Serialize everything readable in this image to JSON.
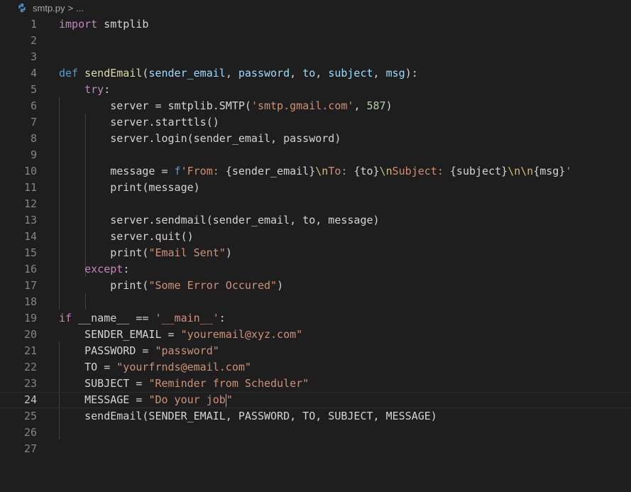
{
  "breadcrumb": {
    "file": "smtp.py",
    "separator": ">",
    "more": "..."
  },
  "lines": [
    {
      "n": "1",
      "code": "import smtplib"
    },
    {
      "n": "2",
      "code": ""
    },
    {
      "n": "3",
      "code": ""
    },
    {
      "n": "4",
      "code": "def sendEmail(sender_email, password, to, subject, msg):"
    },
    {
      "n": "5",
      "code": "    try:"
    },
    {
      "n": "6",
      "code": "        server = smtplib.SMTP('smtp.gmail.com', 587)"
    },
    {
      "n": "7",
      "code": "        server.starttls()"
    },
    {
      "n": "8",
      "code": "        server.login(sender_email, password)"
    },
    {
      "n": "9",
      "code": ""
    },
    {
      "n": "10",
      "code": "        message = f'From: {sender_email}\\nTo: {to}\\nSubject: {subject}\\n\\n{msg}'"
    },
    {
      "n": "11",
      "code": "        print(message)"
    },
    {
      "n": "12",
      "code": ""
    },
    {
      "n": "13",
      "code": "        server.sendmail(sender_email, to, message)"
    },
    {
      "n": "14",
      "code": "        server.quit()"
    },
    {
      "n": "15",
      "code": "        print(\"Email Sent\")"
    },
    {
      "n": "16",
      "code": "    except:"
    },
    {
      "n": "17",
      "code": "        print(\"Some Error Occured\")"
    },
    {
      "n": "18",
      "code": ""
    },
    {
      "n": "19",
      "code": "if __name__ == '__main__':"
    },
    {
      "n": "20",
      "code": "    SENDER_EMAIL = \"youremail@xyz.com\""
    },
    {
      "n": "21",
      "code": "    PASSWORD = \"password\""
    },
    {
      "n": "22",
      "code": "    TO = \"yourfrnds@email.com\""
    },
    {
      "n": "23",
      "code": "    SUBJECT = \"Reminder from Scheduler\""
    },
    {
      "n": "24",
      "code": "    MESSAGE = \"Do your job\""
    },
    {
      "n": "25",
      "code": "    sendEmail(SENDER_EMAIL, PASSWORD, TO, SUBJECT, MESSAGE)"
    },
    {
      "n": "26",
      "code": ""
    },
    {
      "n": "27",
      "code": ""
    }
  ],
  "active_line": 24,
  "colors": {
    "background": "#1e1e1e",
    "keyword": "#569cd6",
    "control_keyword": "#c586c0",
    "string": "#ce9178",
    "number": "#b5cea8",
    "line_number": "#858585"
  },
  "icons": {
    "file_icon": "python-icon",
    "chevron": "chevron-right-icon"
  }
}
